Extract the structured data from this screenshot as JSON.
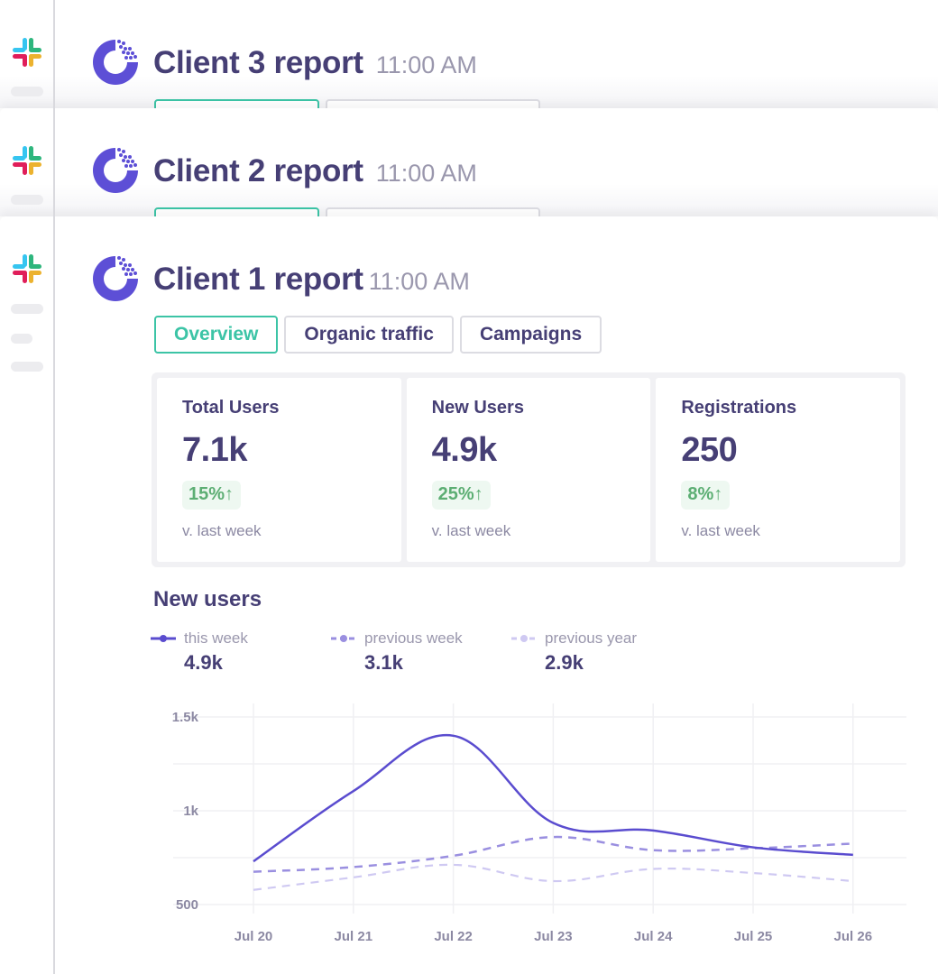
{
  "sidebar": {
    "app_icon": "slack-icon"
  },
  "reports": [
    {
      "title": "Client 3 report",
      "time": "11:00 AM",
      "logo": "analytics-logo-icon"
    },
    {
      "title": "Client 2 report",
      "time": "11:00 AM",
      "logo": "analytics-logo-icon"
    },
    {
      "title": "Client 1 report",
      "time": "11:00 AM",
      "logo": "analytics-logo-icon",
      "tabs": [
        {
          "label": "Overview",
          "active": true
        },
        {
          "label": "Organic traffic",
          "active": false
        },
        {
          "label": "Campaigns",
          "active": false
        }
      ],
      "stats": [
        {
          "label": "Total Users",
          "value": "7.1k",
          "change": "15%↑",
          "sub": "v. last week"
        },
        {
          "label": "New Users",
          "value": "4.9k",
          "change": "25%↑",
          "sub": "v. last week"
        },
        {
          "label": "Registrations",
          "value": "250",
          "change": "8%↑",
          "sub": "v. last week"
        }
      ],
      "chart_section_title": "New users",
      "legend": [
        {
          "label": "this week",
          "value": "4.9k",
          "color": "#5a4ccf",
          "style": "solid"
        },
        {
          "label": "previous week",
          "value": "3.1k",
          "color": "#9a8fe0",
          "style": "dashed"
        },
        {
          "label": "previous year",
          "value": "2.9k",
          "color": "#cfc9f2",
          "style": "dashed"
        }
      ]
    }
  ],
  "colors": {
    "primary_text": "#463f75",
    "accent_teal": "#3cc4a6",
    "positive_green": "#5cae73",
    "series_this_week": "#5a4ccf",
    "series_prev_week": "#9a8fe0",
    "series_prev_year": "#cfc9f2"
  },
  "chart_data": {
    "type": "line",
    "title": "New users",
    "xlabel": "",
    "ylabel": "",
    "categories": [
      "Jul 20",
      "Jul 21",
      "Jul 22",
      "Jul 23",
      "Jul 24",
      "Jul 25",
      "Jul 26"
    ],
    "y_ticks": [
      500,
      1000,
      1500
    ],
    "y_tick_labels": [
      "500",
      "1k",
      "1.5k"
    ],
    "ylim": [
      500,
      1500
    ],
    "grid": true,
    "legend_position": "top-left",
    "series": [
      {
        "name": "this week",
        "values": [
          730,
          1105,
          1400,
          935,
          895,
          805,
          765
        ]
      },
      {
        "name": "previous week",
        "values": [
          675,
          700,
          760,
          860,
          790,
          800,
          825
        ]
      },
      {
        "name": "previous year",
        "values": [
          578,
          645,
          712,
          625,
          690,
          668,
          625
        ]
      }
    ]
  }
}
